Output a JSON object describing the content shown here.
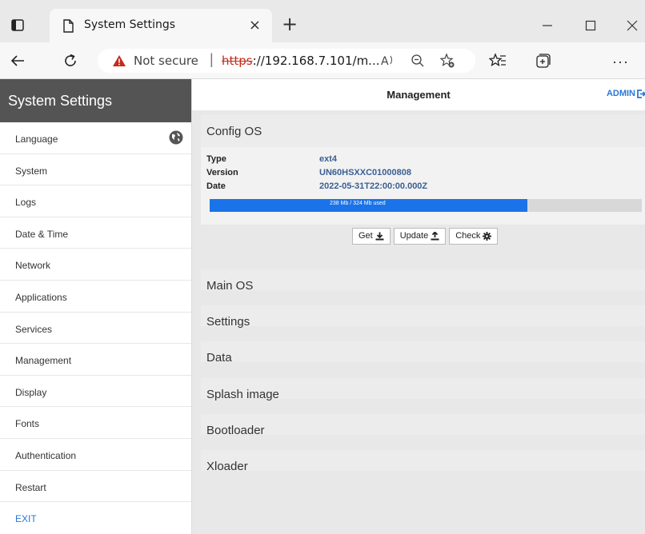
{
  "browser": {
    "tab_title": "System Settings",
    "tab_close": "×",
    "new_tab": "+",
    "not_secure": "Not secure",
    "url_scheme": "https",
    "url_rest": "://192.168.7.101/m...",
    "more": "···"
  },
  "sidebar": {
    "title": "System Settings",
    "items": [
      {
        "label": "Language"
      },
      {
        "label": "System"
      },
      {
        "label": "Logs"
      },
      {
        "label": "Date & Time"
      },
      {
        "label": "Network"
      },
      {
        "label": "Applications"
      },
      {
        "label": "Services"
      },
      {
        "label": "Management"
      },
      {
        "label": "Display"
      },
      {
        "label": "Fonts"
      },
      {
        "label": "Authentication"
      },
      {
        "label": "Restart"
      },
      {
        "label": "EXIT"
      }
    ]
  },
  "topbar": {
    "title": "Management",
    "admin": "ADMIN"
  },
  "config_os": {
    "title": "Config OS",
    "type_label": "Type",
    "type_value": "ext4",
    "version_label": "Version",
    "version_value": "UN60HSXXC01000808",
    "date_label": "Date",
    "date_value": "2022-05-31T22:00:00.000Z",
    "usage_text": "238 Mb / 324 Mb used",
    "usage_fraction": 0.7346,
    "buttons": {
      "get": "Get",
      "update": "Update",
      "check": "Check"
    }
  },
  "sections": [
    {
      "title": "Main OS"
    },
    {
      "title": "Settings"
    },
    {
      "title": "Data"
    },
    {
      "title": "Splash image"
    },
    {
      "title": "Bootloader"
    },
    {
      "title": "Xloader"
    }
  ],
  "colors": {
    "accent": "#2a78d6",
    "progress": "#1a73e8",
    "sidebar_header": "#545454",
    "warning": "#c42b1c"
  }
}
